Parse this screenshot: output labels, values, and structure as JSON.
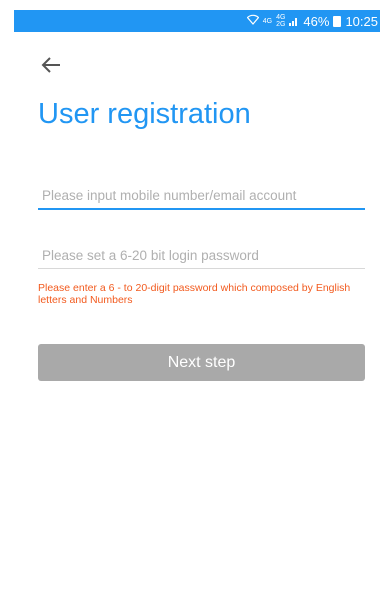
{
  "status_bar": {
    "network_4g": "4G",
    "network_4g_2": "4G",
    "network_2g": "2G",
    "battery_percent": "46%",
    "time": "10:25"
  },
  "header": {
    "back_icon": "←",
    "title": "User registration"
  },
  "form": {
    "account_placeholder": "Please input mobile number/email account",
    "account_value": "",
    "password_placeholder": "Please set a 6-20 bit login password",
    "password_value": "",
    "password_hint": "Please enter a 6 - to 20-digit password which composed by English letters and Numbers",
    "next_label": "Next step"
  },
  "colors": {
    "accent": "#2196f3",
    "error": "#f25a1e",
    "button_disabled": "#a9a9a9"
  },
  "icons": [
    "wifi-icon",
    "signal-icon",
    "battery-icon",
    "back-arrow-icon"
  ]
}
